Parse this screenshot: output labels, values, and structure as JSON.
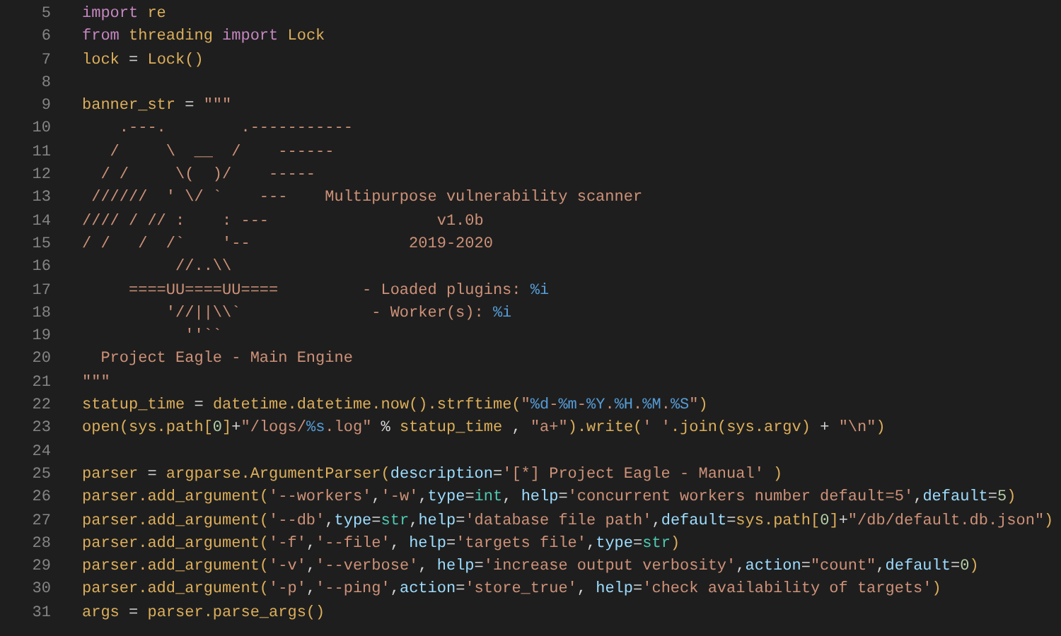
{
  "editor": {
    "lines": [
      {
        "number": "5",
        "tokens": [
          {
            "kind": "kw",
            "text": "import"
          },
          {
            "kind": "id",
            "text": " re"
          }
        ]
      },
      {
        "number": "6",
        "tokens": [
          {
            "kind": "kw",
            "text": "from"
          },
          {
            "kind": "id",
            "text": " threading "
          },
          {
            "kind": "kw",
            "text": "import"
          },
          {
            "kind": "id",
            "text": " Lock"
          }
        ]
      },
      {
        "number": "7",
        "tokens": [
          {
            "kind": "id",
            "text": "lock"
          },
          {
            "kind": "op",
            "text": " = "
          },
          {
            "kind": "id",
            "text": "Lock()"
          }
        ]
      },
      {
        "number": "8"
      },
      {
        "number": "9",
        "tokens": [
          {
            "kind": "id",
            "text": "banner_str"
          },
          {
            "kind": "op",
            "text": " = "
          },
          {
            "kind": "str",
            "text": "\"\"\""
          }
        ]
      },
      {
        "number": "10",
        "tokens": [
          {
            "kind": "str",
            "text": "    .---.        .-----------"
          }
        ]
      },
      {
        "number": "11",
        "tokens": [
          {
            "kind": "str",
            "text": "   /     \\  __  /    ------"
          }
        ]
      },
      {
        "number": "12",
        "tokens": [
          {
            "kind": "str",
            "text": "  / /     \\(  )/    -----"
          }
        ]
      },
      {
        "number": "13",
        "tokens": [
          {
            "kind": "str",
            "text": " //////  ' \\/ `    ---    Multipurpose vulnerability scanner"
          }
        ]
      },
      {
        "number": "14",
        "tokens": [
          {
            "kind": "str",
            "text": "//// / // :    : ---                  v1.0b"
          }
        ]
      },
      {
        "number": "15",
        "tokens": [
          {
            "kind": "str",
            "text": "/ /   /  /`    '--                 2019-2020"
          }
        ]
      },
      {
        "number": "16",
        "tokens": [
          {
            "kind": "str",
            "text": "          //..\\\\"
          }
        ]
      },
      {
        "number": "17",
        "tokens": [
          {
            "kind": "str",
            "text": "     ====UU====UU====         - Loaded plugins: "
          },
          {
            "kind": "fmt",
            "text": "%i"
          }
        ]
      },
      {
        "number": "18",
        "tokens": [
          {
            "kind": "str",
            "text": "         '//||\\\\`              - Worker(s): "
          },
          {
            "kind": "fmt",
            "text": "%i"
          }
        ]
      },
      {
        "number": "19",
        "tokens": [
          {
            "kind": "str",
            "text": "           ''``"
          }
        ]
      },
      {
        "number": "20",
        "tokens": [
          {
            "kind": "str",
            "text": "  Project Eagle - Main Engine"
          }
        ]
      },
      {
        "number": "21",
        "tokens": [
          {
            "kind": "str",
            "text": "\"\"\""
          }
        ]
      },
      {
        "number": "22",
        "tokens": [
          {
            "kind": "id",
            "text": "statup_time"
          },
          {
            "kind": "op",
            "text": " = "
          },
          {
            "kind": "id",
            "text": "datetime.datetime.now().strftime("
          },
          {
            "kind": "str",
            "text": "\""
          },
          {
            "kind": "fmt",
            "text": "%d"
          },
          {
            "kind": "str",
            "text": "-"
          },
          {
            "kind": "fmt",
            "text": "%m"
          },
          {
            "kind": "str",
            "text": "-"
          },
          {
            "kind": "fmt",
            "text": "%Y"
          },
          {
            "kind": "str",
            "text": "."
          },
          {
            "kind": "fmt",
            "text": "%H"
          },
          {
            "kind": "str",
            "text": "."
          },
          {
            "kind": "fmt",
            "text": "%M"
          },
          {
            "kind": "str",
            "text": "."
          },
          {
            "kind": "fmt",
            "text": "%S"
          },
          {
            "kind": "str",
            "text": "\""
          },
          {
            "kind": "id",
            "text": ")"
          }
        ]
      },
      {
        "number": "23",
        "tokens": [
          {
            "kind": "id",
            "text": "open(sys.path["
          },
          {
            "kind": "num",
            "text": "0"
          },
          {
            "kind": "id",
            "text": "]"
          },
          {
            "kind": "op",
            "text": "+"
          },
          {
            "kind": "str",
            "text": "\"/logs/"
          },
          {
            "kind": "fmt",
            "text": "%s"
          },
          {
            "kind": "str",
            "text": ".log\""
          },
          {
            "kind": "op",
            "text": " % "
          },
          {
            "kind": "id",
            "text": "statup_time"
          },
          {
            "kind": "op",
            "text": " , "
          },
          {
            "kind": "str",
            "text": "\"a+\""
          },
          {
            "kind": "id",
            "text": ").write("
          },
          {
            "kind": "str",
            "text": "' '"
          },
          {
            "kind": "id",
            "text": ".join(sys.argv)"
          },
          {
            "kind": "op",
            "text": " + "
          },
          {
            "kind": "str",
            "text": "\"\\n\""
          },
          {
            "kind": "id",
            "text": ")"
          }
        ]
      },
      {
        "number": "24"
      },
      {
        "number": "25",
        "tokens": [
          {
            "kind": "id",
            "text": "parser"
          },
          {
            "kind": "op",
            "text": " = "
          },
          {
            "kind": "id",
            "text": "argparse.ArgumentParser("
          },
          {
            "kind": "param",
            "text": "description"
          },
          {
            "kind": "op",
            "text": "="
          },
          {
            "kind": "str",
            "text": "'[*] Project Eagle - Manual'"
          },
          {
            "kind": "id",
            "text": " )"
          }
        ]
      },
      {
        "number": "26",
        "tokens": [
          {
            "kind": "id",
            "text": "parser.add_argument("
          },
          {
            "kind": "str",
            "text": "'--workers'"
          },
          {
            "kind": "op",
            "text": ","
          },
          {
            "kind": "str",
            "text": "'-w'"
          },
          {
            "kind": "op",
            "text": ","
          },
          {
            "kind": "param",
            "text": "type"
          },
          {
            "kind": "op",
            "text": "="
          },
          {
            "kind": "type",
            "text": "int"
          },
          {
            "kind": "op",
            "text": ", "
          },
          {
            "kind": "param",
            "text": "help"
          },
          {
            "kind": "op",
            "text": "="
          },
          {
            "kind": "str",
            "text": "'concurrent workers number default=5'"
          },
          {
            "kind": "op",
            "text": ","
          },
          {
            "kind": "param",
            "text": "default"
          },
          {
            "kind": "op",
            "text": "="
          },
          {
            "kind": "num",
            "text": "5"
          },
          {
            "kind": "id",
            "text": ")"
          }
        ]
      },
      {
        "number": "27",
        "tokens": [
          {
            "kind": "id",
            "text": "parser.add_argument("
          },
          {
            "kind": "str",
            "text": "'--db'"
          },
          {
            "kind": "op",
            "text": ","
          },
          {
            "kind": "param",
            "text": "type"
          },
          {
            "kind": "op",
            "text": "="
          },
          {
            "kind": "type",
            "text": "str"
          },
          {
            "kind": "op",
            "text": ","
          },
          {
            "kind": "param",
            "text": "help"
          },
          {
            "kind": "op",
            "text": "="
          },
          {
            "kind": "str",
            "text": "'database file path'"
          },
          {
            "kind": "op",
            "text": ","
          },
          {
            "kind": "param",
            "text": "default"
          },
          {
            "kind": "op",
            "text": "="
          },
          {
            "kind": "id",
            "text": "sys.path["
          },
          {
            "kind": "num",
            "text": "0"
          },
          {
            "kind": "id",
            "text": "]"
          },
          {
            "kind": "op",
            "text": "+"
          },
          {
            "kind": "str",
            "text": "\"/db/default.db.json\""
          },
          {
            "kind": "id",
            "text": ")"
          }
        ]
      },
      {
        "number": "28",
        "tokens": [
          {
            "kind": "id",
            "text": "parser.add_argument("
          },
          {
            "kind": "str",
            "text": "'-f'"
          },
          {
            "kind": "op",
            "text": ","
          },
          {
            "kind": "str",
            "text": "'--file'"
          },
          {
            "kind": "op",
            "text": ", "
          },
          {
            "kind": "param",
            "text": "help"
          },
          {
            "kind": "op",
            "text": "="
          },
          {
            "kind": "str",
            "text": "'targets file'"
          },
          {
            "kind": "op",
            "text": ","
          },
          {
            "kind": "param",
            "text": "type"
          },
          {
            "kind": "op",
            "text": "="
          },
          {
            "kind": "type",
            "text": "str"
          },
          {
            "kind": "id",
            "text": ")"
          }
        ]
      },
      {
        "number": "29",
        "tokens": [
          {
            "kind": "id",
            "text": "parser.add_argument("
          },
          {
            "kind": "str",
            "text": "'-v'"
          },
          {
            "kind": "op",
            "text": ","
          },
          {
            "kind": "str",
            "text": "'--verbose'"
          },
          {
            "kind": "op",
            "text": ", "
          },
          {
            "kind": "param",
            "text": "help"
          },
          {
            "kind": "op",
            "text": "="
          },
          {
            "kind": "str",
            "text": "'increase output verbosity'"
          },
          {
            "kind": "op",
            "text": ","
          },
          {
            "kind": "param",
            "text": "action"
          },
          {
            "kind": "op",
            "text": "="
          },
          {
            "kind": "str",
            "text": "\"count\""
          },
          {
            "kind": "op",
            "text": ","
          },
          {
            "kind": "param",
            "text": "default"
          },
          {
            "kind": "op",
            "text": "="
          },
          {
            "kind": "num",
            "text": "0"
          },
          {
            "kind": "id",
            "text": ")"
          }
        ]
      },
      {
        "number": "30",
        "tokens": [
          {
            "kind": "id",
            "text": "parser.add_argument("
          },
          {
            "kind": "str",
            "text": "'-p'"
          },
          {
            "kind": "op",
            "text": ","
          },
          {
            "kind": "str",
            "text": "'--ping'"
          },
          {
            "kind": "op",
            "text": ","
          },
          {
            "kind": "param",
            "text": "action"
          },
          {
            "kind": "op",
            "text": "="
          },
          {
            "kind": "str",
            "text": "'store_true'"
          },
          {
            "kind": "op",
            "text": ", "
          },
          {
            "kind": "param",
            "text": "help"
          },
          {
            "kind": "op",
            "text": "="
          },
          {
            "kind": "str",
            "text": "'check availability of targets'"
          },
          {
            "kind": "id",
            "text": ")"
          }
        ]
      },
      {
        "number": "31",
        "tokens": [
          {
            "kind": "id",
            "text": "args"
          },
          {
            "kind": "op",
            "text": " = "
          },
          {
            "kind": "id",
            "text": "parser.parse_args()"
          }
        ]
      }
    ]
  }
}
